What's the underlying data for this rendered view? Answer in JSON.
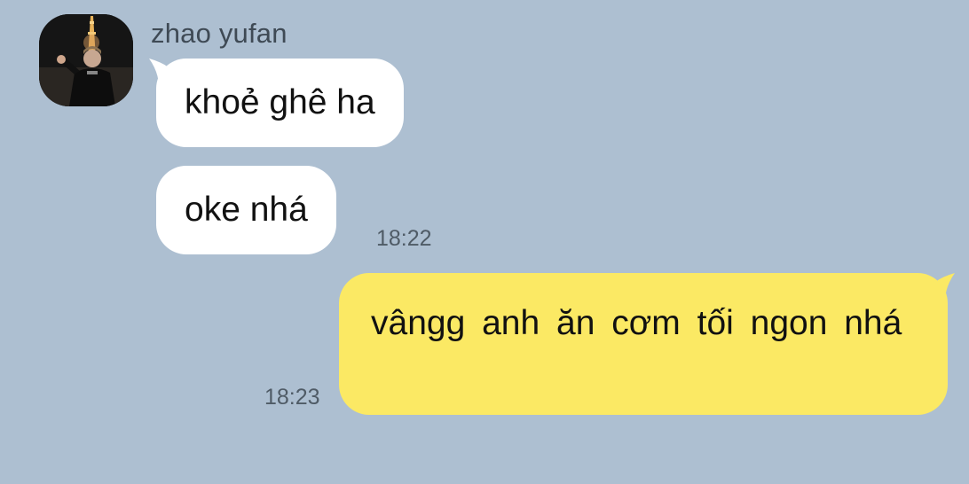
{
  "colors": {
    "background": "#adbfd1",
    "incoming_bubble": "#ffffff",
    "outgoing_bubble": "#fbe964",
    "timestamp_text": "#4f5b66",
    "name_text": "#3f4a55"
  },
  "chat": {
    "sender": {
      "name": "zhao yufan",
      "avatar_icon": "profile-photo"
    },
    "incoming": [
      {
        "text": "khoẻ ghê ha"
      },
      {
        "text": "oke nhá",
        "time": "18:22"
      }
    ],
    "outgoing": [
      {
        "text": "vângg anh ăn cơm tối ngon nhá",
        "time": "18:23"
      }
    ]
  }
}
